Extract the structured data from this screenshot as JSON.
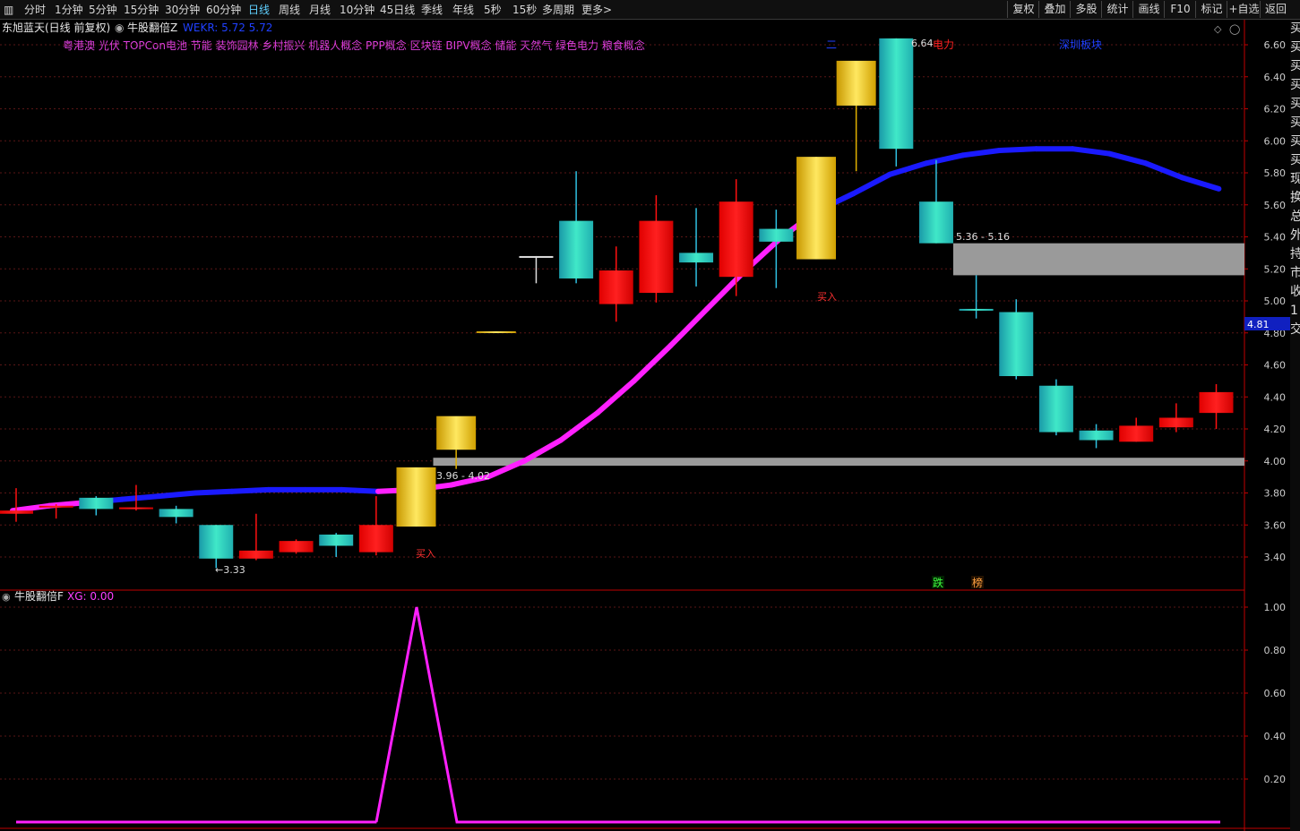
{
  "toolbar": {
    "periods": [
      "分时",
      "1分钟",
      "5分钟",
      "15分钟",
      "30分钟",
      "60分钟",
      "日线",
      "周线",
      "月线",
      "10分钟",
      "45日线",
      "季线",
      "年线",
      "5秒",
      "15秒",
      "多周期",
      "更多>"
    ],
    "active_period": "日线",
    "buttons": [
      "复权",
      "叠加",
      "多股",
      "统计",
      "画线",
      "F10",
      "标记",
      "+自选",
      "返回"
    ]
  },
  "info": {
    "stock": "东旭蓝天(日线 前复权)",
    "indicator": "牛股翻倍Z",
    "wekr": "WEKR: 5.72  5.72",
    "concepts": "粤港澳 光伏 TOPCon电池 节能 装饰园林 乡村振兴 机器人概念 PPP概念 区块链 BIPV概念 储能 天然气 绿色电力 粮食概念",
    "tag_er": "二",
    "tag_power": "电力",
    "tag_sz": "深圳板块"
  },
  "lower_panel": {
    "title": "牛股翻倍F",
    "xg": "XG: 0.00"
  },
  "labels": {
    "price_high": "6.64",
    "price_low": "←3.33",
    "zone_upper": "5.36 - 5.16",
    "zone_lower": "3.96 - 4.02",
    "buy": "买入",
    "fall": "跌",
    "list": "榜",
    "current_price": "4.81"
  },
  "sidebar_text": "买买买买买买买买现换总外持市收1交",
  "chart_data": [
    {
      "type": "candlestick",
      "ylim": [
        3.25,
        6.73
      ],
      "yticks": [
        3.4,
        3.6,
        3.8,
        4.0,
        4.2,
        4.4,
        4.6,
        4.8,
        5.0,
        5.2,
        5.4,
        5.6,
        5.8,
        6.0,
        6.2,
        6.4,
        6.6
      ],
      "candles": [
        {
          "o": 3.69,
          "h": 3.83,
          "l": 3.62,
          "c": 3.67,
          "style": "red"
        },
        {
          "o": 3.72,
          "h": 3.73,
          "l": 3.64,
          "c": 3.71,
          "style": "red"
        },
        {
          "o": 3.7,
          "h": 3.78,
          "l": 3.66,
          "c": 3.77,
          "style": "cyan"
        },
        {
          "o": 3.71,
          "h": 3.85,
          "l": 3.69,
          "c": 3.7,
          "style": "red"
        },
        {
          "o": 3.65,
          "h": 3.72,
          "l": 3.61,
          "c": 3.7,
          "style": "cyan"
        },
        {
          "o": 3.39,
          "h": 3.6,
          "l": 3.33,
          "c": 3.6,
          "style": "cyan"
        },
        {
          "o": 3.44,
          "h": 3.67,
          "l": 3.38,
          "c": 3.39,
          "style": "red"
        },
        {
          "o": 3.5,
          "h": 3.51,
          "l": 3.42,
          "c": 3.43,
          "style": "red"
        },
        {
          "o": 3.47,
          "h": 3.55,
          "l": 3.4,
          "c": 3.54,
          "style": "cyan"
        },
        {
          "o": 3.6,
          "h": 3.78,
          "l": 3.41,
          "c": 3.43,
          "style": "red"
        },
        {
          "o": 3.59,
          "h": 3.93,
          "l": 3.59,
          "c": 3.96,
          "style": "gold"
        },
        {
          "o": 4.07,
          "h": 4.07,
          "l": 3.95,
          "c": 4.28,
          "style": "gold"
        },
        {
          "o": 4.81,
          "h": 4.81,
          "l": 4.81,
          "c": 4.81,
          "style": "gold"
        },
        {
          "o": 5.28,
          "h": 5.28,
          "l": 5.11,
          "c": 5.28,
          "style": "white"
        },
        {
          "o": 5.14,
          "h": 5.81,
          "l": 5.11,
          "c": 5.5,
          "style": "cyan"
        },
        {
          "o": 5.19,
          "h": 5.34,
          "l": 4.87,
          "c": 4.98,
          "style": "red"
        },
        {
          "o": 5.5,
          "h": 5.66,
          "l": 4.99,
          "c": 5.05,
          "style": "red"
        },
        {
          "o": 5.24,
          "h": 5.58,
          "l": 5.09,
          "c": 5.3,
          "style": "cyan"
        },
        {
          "o": 5.62,
          "h": 5.76,
          "l": 5.03,
          "c": 5.15,
          "style": "red"
        },
        {
          "o": 5.37,
          "h": 5.57,
          "l": 5.08,
          "c": 5.45,
          "style": "cyan"
        },
        {
          "o": 5.26,
          "h": 5.9,
          "l": 5.26,
          "c": 5.9,
          "style": "gold"
        },
        {
          "o": 6.22,
          "h": 6.22,
          "l": 5.81,
          "c": 6.5,
          "style": "gold"
        },
        {
          "o": 5.95,
          "h": 6.64,
          "l": 5.84,
          "c": 6.64,
          "style": "cyan"
        },
        {
          "o": 5.36,
          "h": 5.88,
          "l": 5.36,
          "c": 5.62,
          "style": "cyan"
        },
        {
          "o": 4.95,
          "h": 5.16,
          "l": 4.89,
          "c": 4.95,
          "style": "cyan"
        },
        {
          "o": 4.53,
          "h": 5.01,
          "l": 4.51,
          "c": 4.93,
          "style": "cyan"
        },
        {
          "o": 4.18,
          "h": 4.51,
          "l": 4.16,
          "c": 4.47,
          "style": "cyan"
        },
        {
          "o": 4.13,
          "h": 4.23,
          "l": 4.08,
          "c": 4.19,
          "style": "cyan"
        },
        {
          "o": 4.22,
          "h": 4.27,
          "l": 4.12,
          "c": 4.12,
          "style": "red"
        },
        {
          "o": 4.27,
          "h": 4.36,
          "l": 4.18,
          "c": 4.21,
          "style": "red"
        },
        {
          "o": 4.43,
          "h": 4.48,
          "l": 4.2,
          "c": 4.3,
          "style": "red"
        }
      ],
      "ma_line": [
        3.69,
        3.72,
        3.74,
        3.76,
        3.78,
        3.8,
        3.81,
        3.82,
        3.82,
        3.82,
        3.81,
        3.82,
        3.85,
        3.9,
        4.0,
        4.13,
        4.3,
        4.5,
        4.72,
        4.95,
        5.18,
        5.39,
        5.56,
        5.67,
        5.79,
        5.86,
        5.91,
        5.94,
        5.95,
        5.95,
        5.92,
        5.86,
        5.77,
        5.7
      ],
      "ma_colors": [
        "magenta",
        "magenta",
        "blue",
        "blue",
        "blue",
        "blue",
        "blue",
        "blue",
        "blue",
        "blue",
        "magenta",
        "magenta",
        "magenta",
        "magenta",
        "magenta",
        "magenta",
        "magenta",
        "magenta",
        "magenta",
        "magenta",
        "magenta",
        "magenta",
        "blue",
        "blue",
        "blue",
        "blue",
        "blue",
        "blue",
        "blue",
        "blue",
        "blue",
        "blue",
        "blue",
        "blue"
      ],
      "zones": [
        {
          "from_index": 10,
          "low": 3.97,
          "high": 4.02,
          "label": "3.96 - 4.02"
        },
        {
          "from_index": 23,
          "low": 5.16,
          "high": 5.36,
          "label": "5.36 - 5.16"
        }
      ]
    },
    {
      "type": "line",
      "name": "XG",
      "ylim": [
        0,
        1.05
      ],
      "yticks": [
        0.2,
        0.4,
        0.6,
        0.8,
        1.0
      ],
      "x": [
        "0",
        "1",
        "2",
        "3",
        "4",
        "5",
        "6",
        "7",
        "8",
        "9",
        "10",
        "11",
        "12"
      ],
      "values": [
        0,
        0,
        0,
        0,
        0,
        0,
        0,
        0,
        0,
        0,
        1,
        0,
        0
      ]
    }
  ],
  "colors": {
    "up_red": "#ff1010",
    "cyan_top": "#19b4b4",
    "gold": "#f0c800",
    "magenta": "#ff20ff",
    "blue": "#1a1aff",
    "grid": "#5a1616",
    "axis": "#c00000"
  }
}
